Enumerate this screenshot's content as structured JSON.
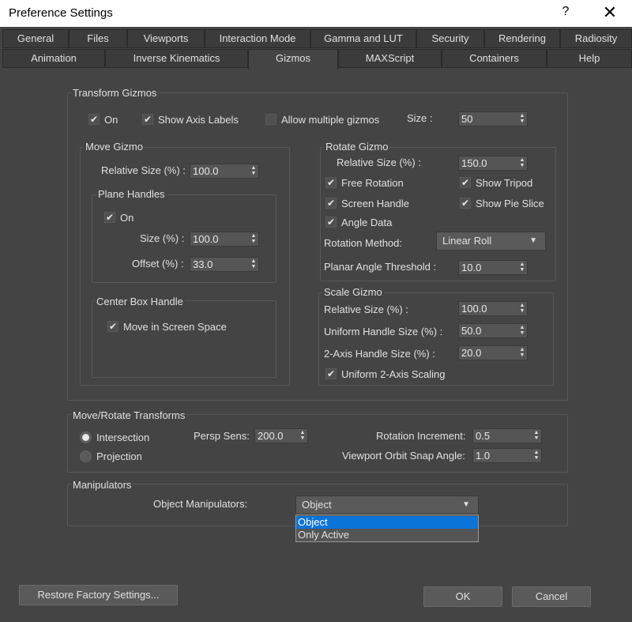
{
  "window": {
    "title": "Preference Settings",
    "help": "?",
    "close": "✕"
  },
  "tabs_row1": [
    "General",
    "Files",
    "Viewports",
    "Interaction Mode",
    "Gamma and LUT",
    "Security",
    "Rendering",
    "Radiosity"
  ],
  "tabs_row2": [
    "Animation",
    "Inverse Kinematics",
    "Gizmos",
    "MAXScript",
    "Containers",
    "Help"
  ],
  "active_tab": "Gizmos",
  "transform": {
    "title": "Transform Gizmos",
    "on_label": "On",
    "on_checked": true,
    "axis_label": "Show Axis Labels",
    "axis_checked": true,
    "multi_label": "Allow multiple gizmos",
    "multi_checked": false,
    "size_label": "Size :",
    "size_value": "50"
  },
  "move": {
    "title": "Move Gizmo",
    "relsize_label": "Relative Size (%) :",
    "relsize_value": "100.0",
    "plane_title": "Plane Handles",
    "plane_on_label": "On",
    "plane_on_checked": true,
    "size_label": "Size (%) :",
    "size_value": "100.0",
    "offset_label": "Offset (%) :",
    "offset_value": "33.0",
    "center_title": "Center Box Handle",
    "screen_label": "Move in Screen Space",
    "screen_checked": true
  },
  "rotate": {
    "title": "Rotate Gizmo",
    "relsize_label": "Relative Size (%) :",
    "relsize_value": "150.0",
    "free_label": "Free Rotation",
    "free_checked": true,
    "tripod_label": "Show Tripod",
    "tripod_checked": true,
    "screen_label": "Screen Handle",
    "screen_checked": true,
    "pie_label": "Show Pie Slice",
    "pie_checked": true,
    "angle_label": "Angle Data",
    "angle_checked": true,
    "method_label": "Rotation Method:",
    "method_value": "Linear Roll",
    "planar_label": "Planar Angle Threshold :",
    "planar_value": "10.0"
  },
  "scale": {
    "title": "Scale Gizmo",
    "relsize_label": "Relative Size (%) :",
    "relsize_value": "100.0",
    "uniform_label": "Uniform Handle Size (%) :",
    "uniform_value": "50.0",
    "twoaxis_label": "2-Axis Handle Size (%) :",
    "twoaxis_value": "20.0",
    "uniform2_label": "Uniform 2-Axis Scaling",
    "uniform2_checked": true
  },
  "moverotate": {
    "title": "Move/Rotate Transforms",
    "intersection_label": "Intersection",
    "projection_label": "Projection",
    "selected": "Intersection",
    "persp_label": "Persp Sens:",
    "persp_value": "200.0",
    "rotinc_label": "Rotation Increment:",
    "rotinc_value": "0.5",
    "orbit_label": "Viewport Orbit Snap Angle:",
    "orbit_value": "1.0"
  },
  "manipulators": {
    "title": "Manipulators",
    "label": "Object Manipulators:",
    "value": "Object",
    "options": [
      "Object",
      "Only Active"
    ],
    "highlighted": "Object"
  },
  "buttons": {
    "restore": "Restore Factory Settings...",
    "ok": "OK",
    "cancel": "Cancel"
  },
  "colors": {
    "dialog_bg": "#444444",
    "tab_bg": "#3b3b3b",
    "field_bg": "#555555",
    "selection": "#0b74d9"
  }
}
